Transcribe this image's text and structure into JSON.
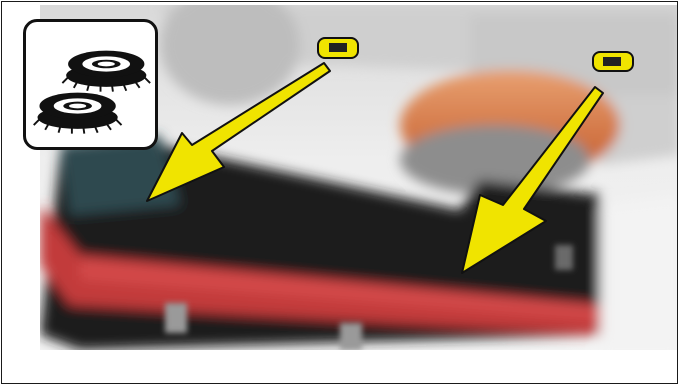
{
  "figure": {
    "icon": "side-brushes-icon",
    "content": "machine-underside-photo-side-brush-mounts",
    "annotation_color": "#f0e400",
    "outline_color": "#111111",
    "arrow_count": 2
  }
}
